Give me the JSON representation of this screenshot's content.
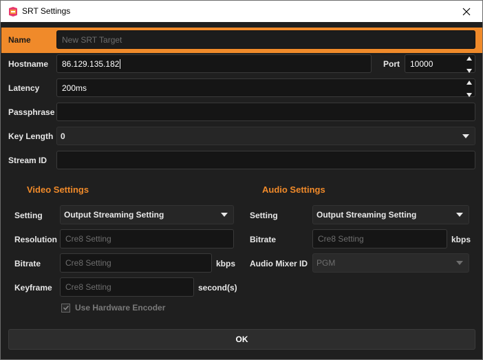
{
  "window": {
    "title": "SRT Settings",
    "app_icon": "app-logo-icon",
    "close_icon": "close-icon"
  },
  "colors": {
    "accent": "#f08a2a",
    "background": "#1f1f1f",
    "input_bg": "#151515",
    "titlebar_bg": "#ffffff"
  },
  "fields": {
    "name_label": "Name",
    "name_placeholder": "New SRT Target",
    "hostname_label": "Hostname",
    "hostname_value": "86.129.135.182",
    "port_label": "Port",
    "port_value": "10000",
    "latency_label": "Latency",
    "latency_value": "200ms",
    "passphrase_label": "Passphrase",
    "passphrase_value": "",
    "key_length_label": "Key Length",
    "key_length_value": "0",
    "stream_id_label": "Stream ID",
    "stream_id_value": ""
  },
  "video": {
    "title": "Video Settings",
    "setting_label": "Setting",
    "setting_value": "Output Streaming Setting",
    "resolution_label": "Resolution",
    "resolution_placeholder": "Cre8 Setting",
    "bitrate_label": "Bitrate",
    "bitrate_placeholder": "Cre8 Setting",
    "bitrate_unit": "kbps",
    "keyframe_label": "Keyframe",
    "keyframe_placeholder": "Cre8 Setting",
    "keyframe_unit": "second(s)",
    "hw_encoder_label": "Use Hardware Encoder",
    "hw_encoder_checked": true
  },
  "audio": {
    "title": "Audio Settings",
    "setting_label": "Setting",
    "setting_value": "Output Streaming Setting",
    "bitrate_label": "Bitrate",
    "bitrate_placeholder": "Cre8 Setting",
    "bitrate_unit": "kbps",
    "mixer_label": "Audio Mixer ID",
    "mixer_value": "PGM"
  },
  "footer": {
    "ok_label": "OK"
  }
}
